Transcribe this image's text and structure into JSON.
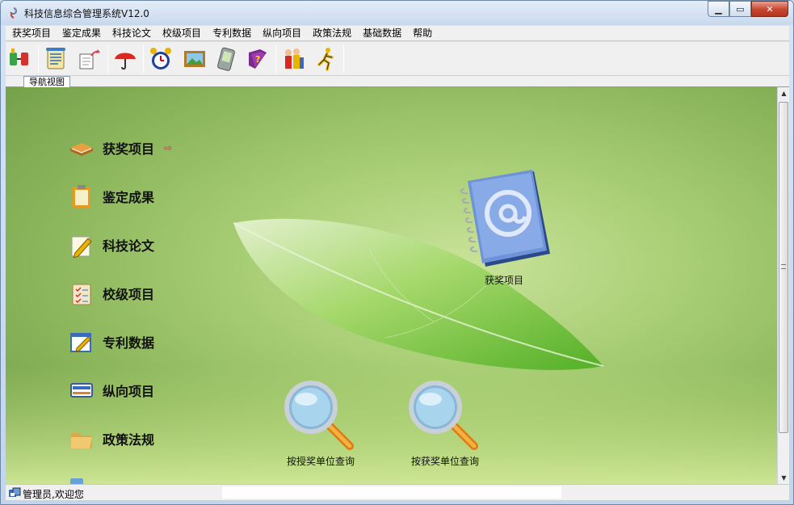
{
  "window": {
    "title": "科技信息综合管理系统V12.0",
    "minimize_glyph": "▁",
    "maximize_glyph": "▭",
    "close_glyph": "✕"
  },
  "menu": [
    "获奖项目",
    "鉴定成果",
    "科技论文",
    "校级项目",
    "专利数据",
    "纵向项目",
    "政策法规",
    "基础数据",
    "帮助"
  ],
  "toolbar": {
    "icons": [
      "connect-icon",
      "document-scroll-icon",
      "export-icon",
      "umbrella-icon",
      "alarm-clock-icon",
      "picture-icon",
      "pda-icon",
      "help-book-icon",
      "users-icon",
      "running-man-icon"
    ]
  },
  "tabs": {
    "nav_view": "导航视图"
  },
  "nav": {
    "items": [
      {
        "label": "获奖项目",
        "icon": "book-icon"
      },
      {
        "label": "鉴定成果",
        "icon": "clipboard-icon"
      },
      {
        "label": "科技论文",
        "icon": "pencil-paper-icon"
      },
      {
        "label": "校级项目",
        "icon": "checklist-icon"
      },
      {
        "label": "专利数据",
        "icon": "edit-window-icon"
      },
      {
        "label": "纵向项目",
        "icon": "card-icon"
      },
      {
        "label": "政策法规",
        "icon": "folder-icon"
      }
    ],
    "active_arrow": "⇨"
  },
  "content": {
    "address_book_label": "获奖项目",
    "query_award_unit_label": "按授奖单位查询",
    "query_winner_unit_label": "按获奖单位查询"
  },
  "status": {
    "text": "管理员,欢迎您"
  },
  "colors": {
    "accent": "#4a6fb3",
    "leaf": "#7cc43a",
    "background": "#a7cd74"
  }
}
